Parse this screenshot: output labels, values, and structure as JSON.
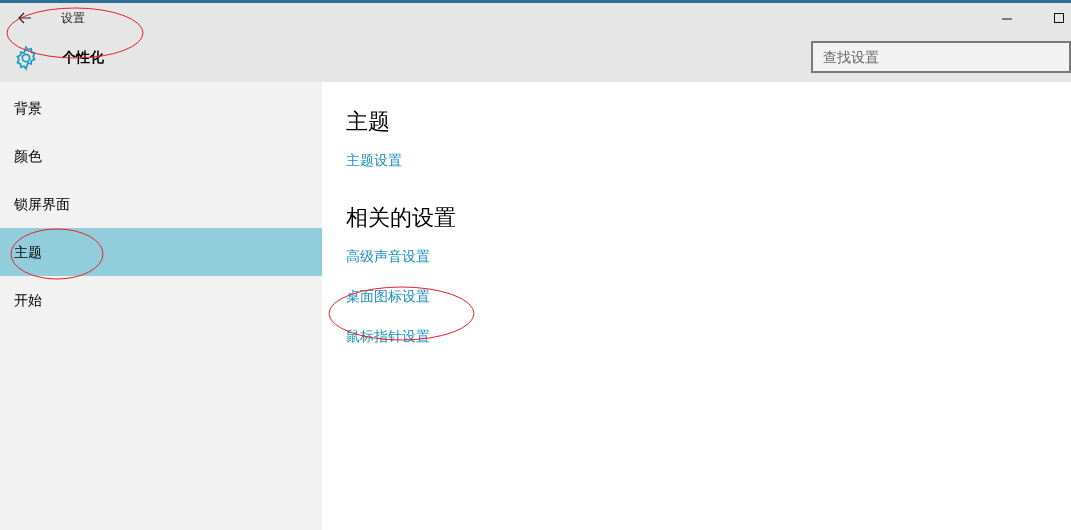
{
  "window": {
    "title": "设置"
  },
  "header": {
    "title": "个性化"
  },
  "search": {
    "placeholder": "查找设置"
  },
  "sidebar": {
    "items": [
      {
        "label": "背景",
        "selected": false
      },
      {
        "label": "颜色",
        "selected": false
      },
      {
        "label": "锁屏界面",
        "selected": false
      },
      {
        "label": "主题",
        "selected": true
      },
      {
        "label": "开始",
        "selected": false
      }
    ]
  },
  "content": {
    "sections": [
      {
        "heading": "主题",
        "links": [
          "主题设置"
        ]
      },
      {
        "heading": "相关的设置",
        "links": [
          "高级声音设置",
          "桌面图标设置",
          "鼠标指针设置"
        ]
      }
    ]
  }
}
